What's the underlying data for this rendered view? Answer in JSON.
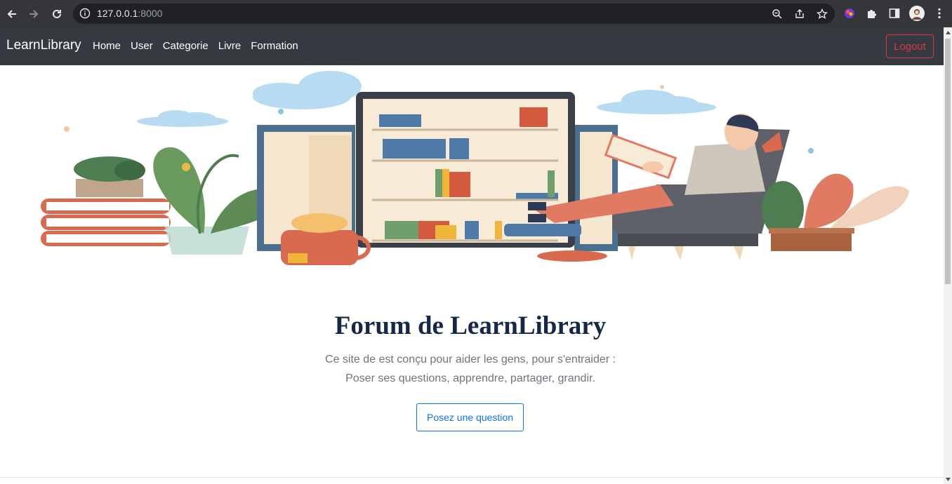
{
  "browser": {
    "url_host": "127.0.0.1",
    "url_port": ":8000"
  },
  "navbar": {
    "brand": "LearnLibrary",
    "links": [
      "Home",
      "User",
      "Categorie",
      "Livre",
      "Formation"
    ],
    "logout_label": "Logout"
  },
  "main": {
    "title": "Forum de LearnLibrary",
    "subtitle_line1": "Ce site de est conçu pour aider les gens, pour s'entraider :",
    "subtitle_line2": "Poser ses questions, apprendre, partager, grandir.",
    "ask_button": "Posez une question"
  },
  "colors": {
    "navbar_bg": "#343a40",
    "logout": "#dc3545",
    "primary": "#0d6efd",
    "title": "#152848"
  }
}
